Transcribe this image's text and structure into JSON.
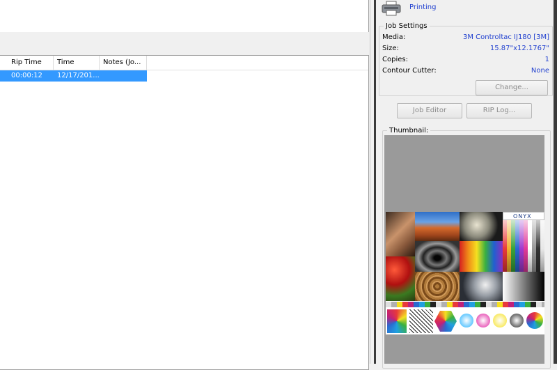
{
  "list": {
    "columns": [
      "Rip Time",
      "Time",
      "Notes (Jo..."
    ],
    "rows": [
      {
        "rip_time": "00:00:12",
        "time": "12/17/201..."
      }
    ]
  },
  "status": {
    "text": "Printing",
    "icon": "printer-icon"
  },
  "job_settings": {
    "title": "Job Settings",
    "fields": [
      {
        "label": "Media:",
        "value": "3M Controltac IJ180 [3M]"
      },
      {
        "label": "Size:",
        "value": "15.87\"x12.1767\""
      },
      {
        "label": "Copies:",
        "value": "1"
      },
      {
        "label": "Contour Cutter:",
        "value": "None"
      }
    ],
    "change_label": "Change..."
  },
  "buttons": {
    "job_editor": "Job Editor",
    "rip_log": "RIP Log..."
  },
  "thumbnail": {
    "title": "Thumbnail:",
    "logo_text": "ONYX"
  },
  "colors": {
    "selection": "#3399ff",
    "value_text": "#1f3fcf"
  }
}
